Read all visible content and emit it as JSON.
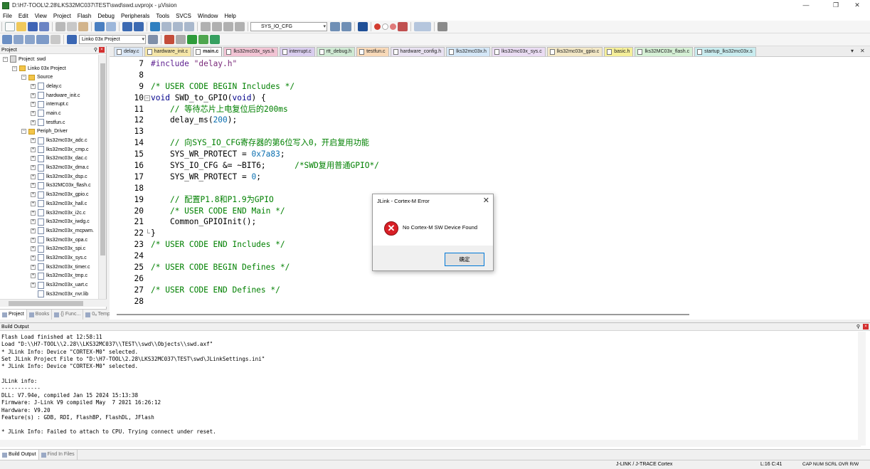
{
  "window": {
    "title": "D:\\H7-TOOL\\2.28\\LKS32MC037\\TEST\\swd\\swd.uvprojx - µVision"
  },
  "menu": [
    "File",
    "Edit",
    "View",
    "Project",
    "Flash",
    "Debug",
    "Peripherals",
    "Tools",
    "SVCS",
    "Window",
    "Help"
  ],
  "toolbar": {
    "symbol_combo": "SYS_IO_CFG",
    "target_combo": "Linko 03x Project"
  },
  "project_panel": {
    "header": "Project",
    "tree": [
      {
        "label": "Project: swd",
        "level": 0,
        "kind": "proj",
        "exp": "−"
      },
      {
        "label": "Linko 03x Project",
        "level": 1,
        "kind": "folder",
        "exp": "−"
      },
      {
        "label": "Source",
        "level": 2,
        "kind": "folder",
        "exp": "−"
      },
      {
        "label": "delay.c",
        "level": 3,
        "kind": "file",
        "exp": "+"
      },
      {
        "label": "hardware_init.c",
        "level": 3,
        "kind": "file",
        "exp": "+"
      },
      {
        "label": "interrupt.c",
        "level": 3,
        "kind": "file",
        "exp": "+"
      },
      {
        "label": "main.c",
        "level": 3,
        "kind": "file",
        "exp": "+"
      },
      {
        "label": "testfun.c",
        "level": 3,
        "kind": "file",
        "exp": "+"
      },
      {
        "label": "Periph_Driver",
        "level": 2,
        "kind": "folder",
        "exp": "−"
      },
      {
        "label": "lks32mc03x_adc.c",
        "level": 3,
        "kind": "file",
        "exp": "+"
      },
      {
        "label": "lks32mc03x_cmp.c",
        "level": 3,
        "kind": "file",
        "exp": "+"
      },
      {
        "label": "lks32mc03x_dac.c",
        "level": 3,
        "kind": "file",
        "exp": "+"
      },
      {
        "label": "lks32mc03x_dma.c",
        "level": 3,
        "kind": "file",
        "exp": "+"
      },
      {
        "label": "lks32mc03x_dsp.c",
        "level": 3,
        "kind": "file",
        "exp": "+"
      },
      {
        "label": "lks32MC03x_flash.c",
        "level": 3,
        "kind": "file",
        "exp": "+"
      },
      {
        "label": "lks32mc03x_gpio.c",
        "level": 3,
        "kind": "file",
        "exp": "+"
      },
      {
        "label": "lks32mc03x_hall.c",
        "level": 3,
        "kind": "file",
        "exp": "+"
      },
      {
        "label": "lks32mc03x_i2c.c",
        "level": 3,
        "kind": "file",
        "exp": "+"
      },
      {
        "label": "lks32mc03x_iwdg.c",
        "level": 3,
        "kind": "file",
        "exp": "+"
      },
      {
        "label": "lks32mc03x_mcpwm.",
        "level": 3,
        "kind": "file",
        "exp": "+"
      },
      {
        "label": "lks32mc03x_opa.c",
        "level": 3,
        "kind": "file",
        "exp": "+"
      },
      {
        "label": "lks32mc03x_spi.c",
        "level": 3,
        "kind": "file",
        "exp": "+"
      },
      {
        "label": "lks32mc03x_sys.c",
        "level": 3,
        "kind": "file",
        "exp": "+"
      },
      {
        "label": "lks32mc03x_timer.c",
        "level": 3,
        "kind": "file",
        "exp": "+"
      },
      {
        "label": "lks32mc03x_tmp.c",
        "level": 3,
        "kind": "file",
        "exp": "+"
      },
      {
        "label": "lks32mc03x_uart.c",
        "level": 3,
        "kind": "file",
        "exp": "+"
      },
      {
        "label": "lks32mc03x_nvr.lib",
        "level": 3,
        "kind": "file",
        "exp": ""
      }
    ],
    "tabs": [
      {
        "label": "Project",
        "active": true
      },
      {
        "label": "Books",
        "active": false
      },
      {
        "label": "{} Func...",
        "active": false
      },
      {
        "label": "0ₐ Temp...",
        "active": false
      }
    ]
  },
  "editor": {
    "tabs": [
      {
        "label": "delay.c",
        "color": "#d9e6f5",
        "active": false
      },
      {
        "label": "hardware_init.c",
        "color": "#f5e6a8",
        "active": false
      },
      {
        "label": "main.c",
        "color": "#ffffff",
        "active": true
      },
      {
        "label": "lks32mc03x_sys.h",
        "color": "#f2c4d4",
        "active": false
      },
      {
        "label": "interrupt.c",
        "color": "#d9cdee",
        "active": false
      },
      {
        "label": "rtt_debug.h",
        "color": "#cfe9d3",
        "active": false
      },
      {
        "label": "testfun.c",
        "color": "#f8d9b8",
        "active": false
      },
      {
        "label": "hardware_config.h",
        "color": "#e9e2f2",
        "active": false
      },
      {
        "label": "lks32mc03x.h",
        "color": "#d4e7f7",
        "active": false
      },
      {
        "label": "lks32mc03x_sys.c",
        "color": "#eadcf3",
        "active": false
      },
      {
        "label": "lks32mc03x_gpio.c",
        "color": "#f3e8c6",
        "active": false
      },
      {
        "label": "basic.h",
        "color": "#f5ef9a",
        "active": false
      },
      {
        "label": "lks32MC03x_flash.c",
        "color": "#d5f0d5",
        "active": false
      },
      {
        "label": "startup_lks32mc03x.s",
        "color": "#c9ecef",
        "active": false
      }
    ],
    "code_lines": [
      {
        "n": "7",
        "fold": "",
        "tokens": [
          [
            "pp",
            "#include "
          ],
          [
            "st",
            "\"delay.h\""
          ]
        ]
      },
      {
        "n": "8",
        "fold": "",
        "tokens": []
      },
      {
        "n": "9",
        "fold": "",
        "tokens": [
          [
            "cm",
            "/* USER CODE BEGIN Includes */"
          ]
        ]
      },
      {
        "n": "10",
        "fold": "−",
        "tokens": [
          [
            "kw",
            "void"
          ],
          [
            "tx",
            " SWD_to_GPIO("
          ],
          [
            "kw",
            "void"
          ],
          [
            "tx",
            ") {"
          ]
        ]
      },
      {
        "n": "11",
        "fold": "",
        "tokens": [
          [
            "tx",
            "    "
          ],
          [
            "cm",
            "// 等待芯片上电复位后的200ms"
          ]
        ]
      },
      {
        "n": "12",
        "fold": "",
        "tokens": [
          [
            "tx",
            "    delay_ms("
          ],
          [
            "nm",
            "200"
          ],
          [
            "tx",
            ");"
          ]
        ]
      },
      {
        "n": "13",
        "fold": "",
        "tokens": []
      },
      {
        "n": "14",
        "fold": "",
        "tokens": [
          [
            "tx",
            "    "
          ],
          [
            "cm",
            "// 向SYS_IO_CFG寄存器的第6位写入0，开启复用功能"
          ]
        ]
      },
      {
        "n": "15",
        "fold": "",
        "tokens": [
          [
            "tx",
            "    SYS_WR_PROTECT = "
          ],
          [
            "nm",
            "0x7a83"
          ],
          [
            "tx",
            ";"
          ]
        ]
      },
      {
        "n": "16",
        "fold": "",
        "tokens": [
          [
            "tx",
            "    SYS_IO_CFG &= ~BIT6;      "
          ],
          [
            "cm",
            "/*SWD复用普通GPIO*/"
          ]
        ]
      },
      {
        "n": "17",
        "fold": "",
        "tokens": [
          [
            "tx",
            "    SYS_WR_PROTECT = "
          ],
          [
            "nm",
            "0"
          ],
          [
            "tx",
            ";"
          ]
        ]
      },
      {
        "n": "18",
        "fold": "",
        "tokens": []
      },
      {
        "n": "19",
        "fold": "",
        "tokens": [
          [
            "tx",
            "    "
          ],
          [
            "cm",
            "// 配置P1.8和P1.9为GPIO"
          ]
        ]
      },
      {
        "n": "20",
        "fold": "",
        "tokens": [
          [
            "tx",
            "    "
          ],
          [
            "cm",
            "/* USER CODE END Main */"
          ]
        ]
      },
      {
        "n": "21",
        "fold": "",
        "tokens": [
          [
            "tx",
            "    Common_GPIOInit();"
          ]
        ]
      },
      {
        "n": "22",
        "fold": "end",
        "tokens": [
          [
            "tx",
            "}"
          ]
        ]
      },
      {
        "n": "23",
        "fold": "",
        "tokens": [
          [
            "cm",
            "/* USER CODE END Includes */"
          ]
        ]
      },
      {
        "n": "24",
        "fold": "",
        "tokens": []
      },
      {
        "n": "25",
        "fold": "",
        "tokens": [
          [
            "cm",
            "/* USER CODE BEGIN Defines */"
          ]
        ]
      },
      {
        "n": "26",
        "fold": "",
        "tokens": []
      },
      {
        "n": "27",
        "fold": "",
        "tokens": [
          [
            "cm",
            "/* USER CODE END Defines */"
          ]
        ]
      },
      {
        "n": "28",
        "fold": "",
        "tokens": []
      }
    ]
  },
  "dialog": {
    "title": "JLink - Cortex-M Error",
    "message": "No Cortex-M SW Device Found",
    "ok_label": "确定"
  },
  "build_output": {
    "header": "Build Output",
    "lines": [
      "Flash Load finished at 12:58:11",
      "Load \"D:\\\\H7-TOOL\\\\2.28\\\\LKS32MC037\\\\TEST\\\\swd\\\\Objects\\\\swd.axf\"",
      "* JLink Info: Device \"CORTEX-M0\" selected.",
      "Set JLink Project File to \"D:\\H7-TOOL\\2.28\\LKS32MC037\\TEST\\swd\\JLinkSettings.ini\"",
      "* JLink Info: Device \"CORTEX-M0\" selected.",
      "",
      "JLink info:",
      "------------",
      "DLL: V7.94e, compiled Jan 15 2024 15:13:38",
      "Firmware: J-Link V9 compiled May  7 2021 16:26:12",
      "Hardware: V9.20",
      "Feature(s) : GDB, RDI, FlashBP, FlashDL, JFlash",
      "",
      "* JLink Info: Failed to attach to CPU. Trying connect under reset."
    ],
    "tabs": [
      {
        "label": "Build Output",
        "active": true
      },
      {
        "label": "Find In Files",
        "active": false
      }
    ]
  },
  "status": {
    "debugger": "J-LINK / J-TRACE Cortex",
    "position": "L:16 C:41",
    "keys": "CAP  NUM  SCRL  OVR  R/W"
  }
}
